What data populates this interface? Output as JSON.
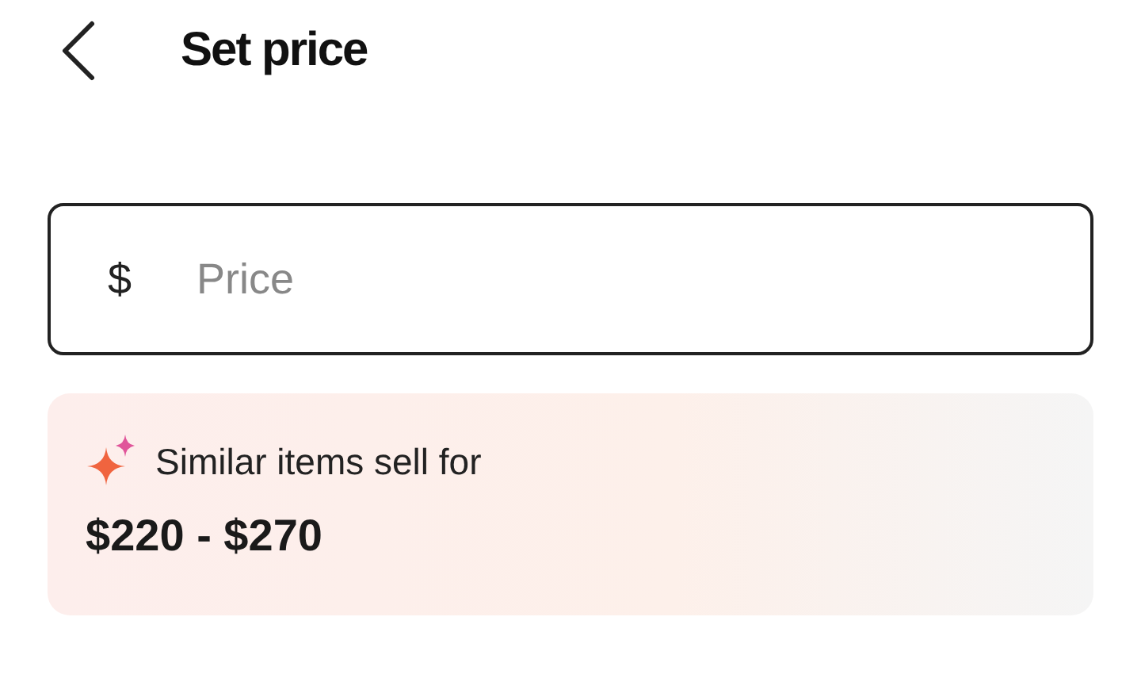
{
  "header": {
    "title": "Set price"
  },
  "price_field": {
    "currency": "$",
    "placeholder": "Price"
  },
  "suggestion": {
    "label": "Similar items sell for",
    "range": "$220 - $270"
  }
}
